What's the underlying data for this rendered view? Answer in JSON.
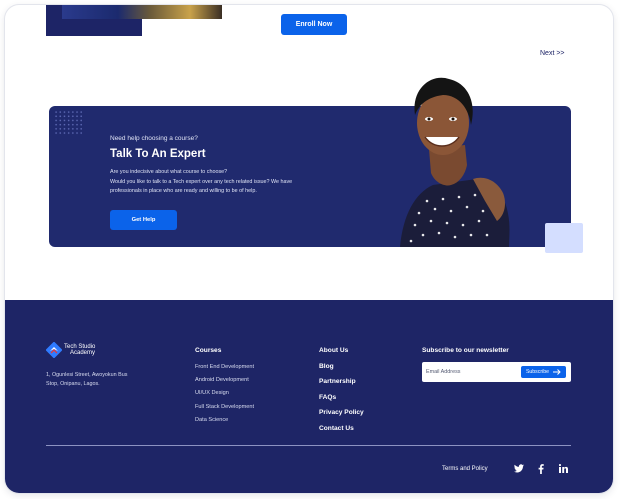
{
  "course_card": {
    "enroll_label": "Enroll Now"
  },
  "pagination": {
    "next_label": "Next >>"
  },
  "expert_banner": {
    "question": "Need help choosing a course?",
    "title": "Talk To An Expert",
    "description_lines": [
      "Are you indecisive about what course to choose?",
      "Would you like to talk to a Tech expert over any tech related issue? We have",
      "professionals in place who are ready and willing to be of help."
    ],
    "cta_label": "Get Help"
  },
  "footer": {
    "logo": {
      "line1": "Tech Studio",
      "line2": "Academy"
    },
    "address_lines": [
      "1, Ogunlesi Street, Awoyokun Bus",
      "Stop, Onipanu, Lagos."
    ],
    "courses": {
      "title": "Courses",
      "items": [
        "Front End Development",
        "Android Development",
        "UI/UX Design",
        "Full Stack Development",
        "Data Science"
      ]
    },
    "links": [
      "About Us",
      "Blog",
      "Partnership",
      "FAQs",
      "Privacy Policy",
      "Contact Us"
    ],
    "newsletter": {
      "title": "Subscribe to our newsletter",
      "placeholder": "Email Address",
      "button_label": "Subscribe"
    },
    "terms_label": "Terms and Policy",
    "social_icons": [
      "twitter-icon",
      "facebook-icon",
      "linkedin-icon"
    ]
  },
  "colors": {
    "navy": "#1e2566",
    "banner_navy": "#202a6e",
    "accent_blue": "#0b63ea",
    "light_square": "#d4deff"
  }
}
